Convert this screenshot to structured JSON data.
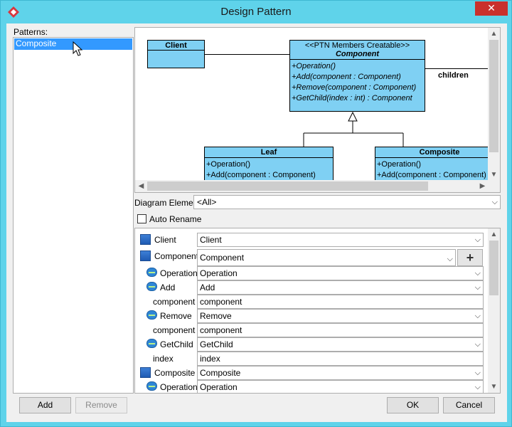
{
  "window": {
    "title": "Design Pattern",
    "close_label": "✕"
  },
  "patterns": {
    "label": "Patterns:",
    "items": [
      "Composite"
    ]
  },
  "diagram": {
    "client": {
      "name": "Client"
    },
    "component": {
      "stereotype": "<<PTN Members Creatable>>",
      "name": "Component",
      "ops": [
        "+Operation()",
        "+Add(component : Component)",
        "+Remove(component : Component)",
        "+GetChild(index : int) : Component"
      ]
    },
    "leaf": {
      "name": "Leaf",
      "ops": [
        "+Operation()",
        "+Add(component : Component)"
      ]
    },
    "composite": {
      "name": "Composite",
      "ops": [
        "+Operation()",
        "+Add(component : Component)"
      ]
    },
    "assoc_label": "children"
  },
  "diagram_element": {
    "label": "Diagram Element",
    "value": "<All>"
  },
  "auto_rename": {
    "label": "Auto Rename",
    "checked": false
  },
  "properties": {
    "rows": [
      {
        "kind": "class",
        "label": "Client",
        "value": "Client",
        "dropdown": true
      },
      {
        "kind": "class",
        "label": "Component",
        "value": "Component",
        "dropdown": true,
        "add_button": true
      },
      {
        "kind": "op",
        "label": "Operation",
        "value": "Operation",
        "dropdown": true
      },
      {
        "kind": "op",
        "label": "Add",
        "value": "Add",
        "dropdown": true
      },
      {
        "kind": "param",
        "label": "component",
        "value": "component",
        "dropdown": false
      },
      {
        "kind": "op",
        "label": "Remove",
        "value": "Remove",
        "dropdown": true
      },
      {
        "kind": "param",
        "label": "component",
        "value": "component",
        "dropdown": false
      },
      {
        "kind": "op",
        "label": "GetChild",
        "value": "GetChild",
        "dropdown": true
      },
      {
        "kind": "param",
        "label": "index",
        "value": "index",
        "dropdown": false
      },
      {
        "kind": "class",
        "label": "Composite",
        "value": "Composite",
        "dropdown": true
      },
      {
        "kind": "op",
        "label": "Operation",
        "value": "Operation",
        "dropdown": true
      }
    ]
  },
  "buttons": {
    "add": "Add",
    "remove": "Remove",
    "ok": "OK",
    "cancel": "Cancel"
  }
}
